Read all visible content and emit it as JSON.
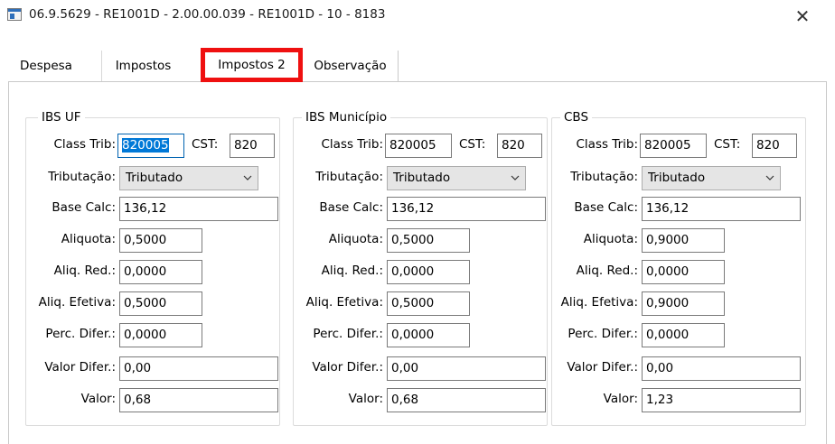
{
  "window": {
    "title": "06.9.5629 - RE1001D - 2.00.00.039 - RE1001D - 10 - 8183",
    "close_glyph": "✕"
  },
  "tabs": [
    "Despesa",
    "Impostos",
    "Impostos 2",
    "Observação"
  ],
  "labels": {
    "class_trib": "Class Trib:",
    "cst": "CST:",
    "tributacao": "Tributação:",
    "base_calc": "Base Calc:",
    "aliquota": "Aliquota:",
    "aliq_red": "Aliq. Red.:",
    "aliq_efetiva": "Aliq. Efetiva:",
    "perc_difer": "Perc. Difer.:",
    "valor_difer": "Valor Difer.:",
    "valor": "Valor:"
  },
  "groups": [
    {
      "title": "IBS UF",
      "class_trib": "820005",
      "cst": "820",
      "tributacao": "Tributado",
      "base_calc": "136,12",
      "aliquota": "0,5000",
      "aliq_red": "0,0000",
      "aliq_efetiva": "0,5000",
      "perc_difer": "0,0000",
      "valor_difer": "0,00",
      "valor": "0,68"
    },
    {
      "title": "IBS Município",
      "class_trib": "820005",
      "cst": "820",
      "tributacao": "Tributado",
      "base_calc": "136,12",
      "aliquota": "0,5000",
      "aliq_red": "0,0000",
      "aliq_efetiva": "0,5000",
      "perc_difer": "0,0000",
      "valor_difer": "0,00",
      "valor": "0,68"
    },
    {
      "title": "CBS",
      "class_trib": "820005",
      "cst": "820",
      "tributacao": "Tributado",
      "base_calc": "136,12",
      "aliquota": "0,9000",
      "aliq_red": "0,0000",
      "aliq_efetiva": "0,9000",
      "perc_difer": "0,0000",
      "valor_difer": "0,00",
      "valor": "1,23"
    }
  ],
  "colors": {
    "highlight": "#ef1010",
    "selection": "#0078d7"
  }
}
